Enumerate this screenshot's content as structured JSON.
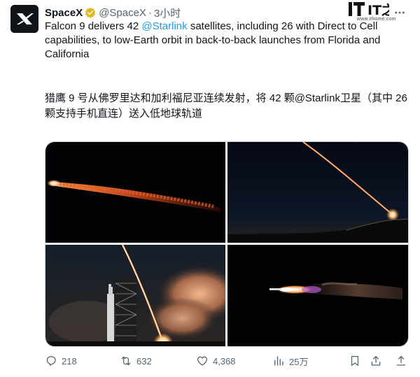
{
  "author": {
    "name": "SpaceX",
    "handle": "@SpaceX",
    "separator": "·",
    "time": "3小时",
    "avatar_icon": "spacex-x-logo",
    "verified_icon": "verified-badge"
  },
  "watermark": {
    "logo_text": "IT之家",
    "url": "www.ithome.com"
  },
  "text": {
    "en_part1": "Falcon 9 delivers 42 ",
    "en_mention": "@Starlink",
    "en_part2": " satellites, including 26 with Direct to Cell capabilities, to low-Earth orbit in back-to-back launches from Florida and California",
    "zh": "猎鹰 9 号从佛罗里达和加利福尼亚连续发射，将 42 颗@Starlink卫星（其中 26 颗支持手机直连）送入低地球轨道"
  },
  "media": {
    "photos": [
      {
        "icon": "rocket-night-photo"
      },
      {
        "icon": "launch-trail-photo"
      },
      {
        "icon": "launch-pad-photo"
      },
      {
        "icon": "rocket-flame-photo"
      }
    ]
  },
  "actions": {
    "reply_count": "218",
    "retweet_count": "632",
    "like_count": "4,368",
    "views_count": "25万"
  },
  "colors": {
    "accent": "#1d9bf0",
    "secondary_text": "#536471",
    "verified": "#e2b719"
  }
}
